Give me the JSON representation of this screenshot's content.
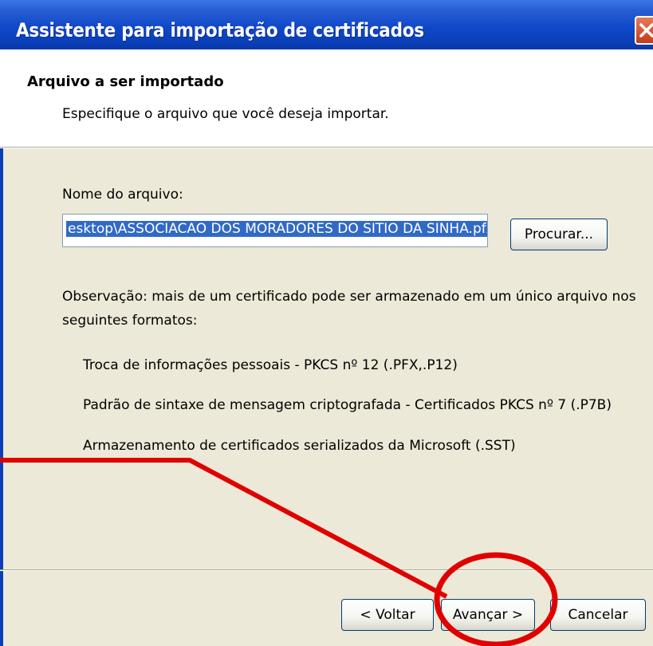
{
  "window": {
    "title": "Assistente para importação de certificados"
  },
  "header": {
    "title": "Arquivo a ser importado",
    "subtitle": "Especifique o arquivo que você deseja importar."
  },
  "file": {
    "label": "Nome do arquivo:",
    "value": "esktop\\ASSOCIACAO DOS MORADORES DO SITIO DA SINHA.pfx",
    "browse_label": "Procurar..."
  },
  "note": {
    "line1": "Observação: mais de um certificado pode ser armazenado em um único arquivo nos",
    "line2": "seguintes formatos:"
  },
  "formats": [
    "Troca de informações pessoais - PKCS nº 12 (.PFX,.P12)",
    "Padrão de sintaxe de mensagem criptografada - Certificados PKCS nº 7 (.P7B)",
    "Armazenamento de certificados serializados da Microsoft (.SST)"
  ],
  "footer": {
    "back_label": "< Voltar",
    "next_label": "Avançar >",
    "cancel_label": "Cancelar"
  },
  "colors": {
    "titlebar": "#0a3fb8",
    "selection": "#316ac5",
    "annotation": "#e00000"
  }
}
